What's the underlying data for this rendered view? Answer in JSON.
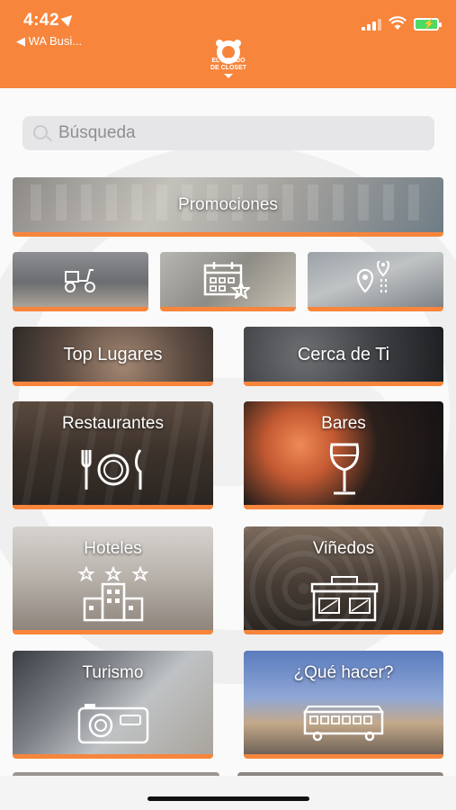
{
  "status_bar": {
    "time": "4:42",
    "back_label": "◀ WA Busi...",
    "battery_icon": "charging-battery-icon"
  },
  "header": {
    "logo_text_1": "EL GORDO",
    "logo_text_2": "DE CLOSET",
    "brand_color": "#f7853c"
  },
  "search": {
    "placeholder": "Búsqueda"
  },
  "tiles": {
    "promociones": "Promociones",
    "top_lugares": "Top Lugares",
    "cerca_de_ti": "Cerca de Ti",
    "restaurantes": "Restaurantes",
    "bares": "Bares",
    "hoteles": "Hoteles",
    "vinedos": "Viñedos",
    "turismo": "Turismo",
    "que_hacer": "¿Qué hacer?"
  },
  "icons": [
    "scooter-icon",
    "calendar-star-icon",
    "map-pin-icon",
    "cutlery-plate-icon",
    "wine-glass-icon",
    "hotel-building-icon",
    "store-front-icon",
    "camera-icon",
    "trolley-bus-icon"
  ]
}
